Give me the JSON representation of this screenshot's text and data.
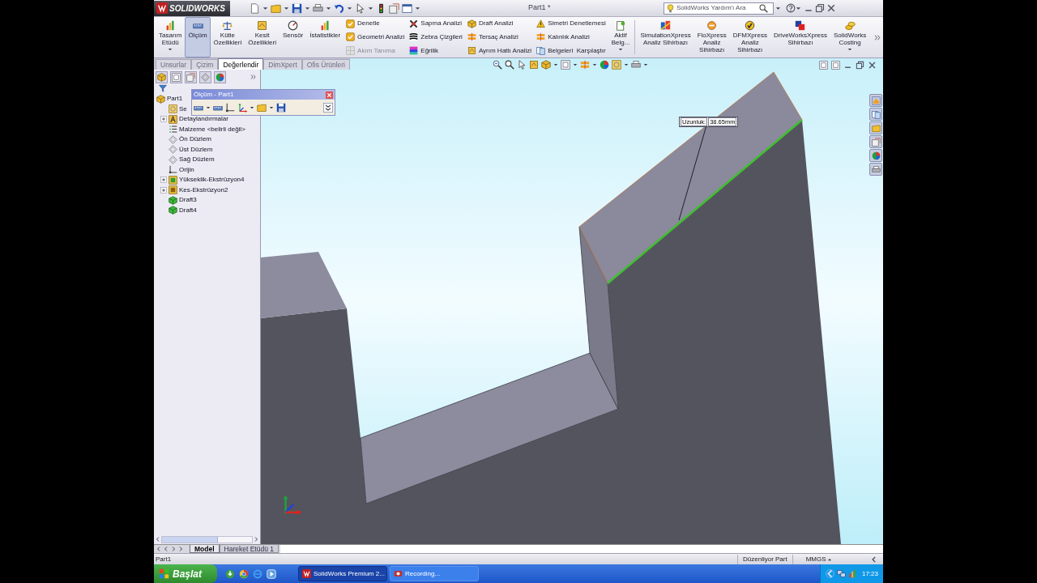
{
  "title_bar": {
    "logo": "SOLIDWORKS",
    "title": "Part1 *",
    "search": {
      "placeholder": "SolidWorks Yardım'ı Ara"
    }
  },
  "ribbon": [
    {
      "kind": "large",
      "label": "Tasarım\nEtüdü",
      "selected": false,
      "menu": true
    },
    {
      "kind": "large",
      "label": "Ölçüm",
      "selected": true
    },
    {
      "kind": "large",
      "label": "Kütle\nÖzellikleri",
      "selected": false
    },
    {
      "kind": "large",
      "label": "Kesit\nÖzellikleri",
      "selected": false
    },
    {
      "kind": "large",
      "label": "Sensör",
      "selected": false
    },
    {
      "kind": "large",
      "label": "İstatistikler",
      "selected": false
    },
    {
      "kind": "column",
      "items": [
        {
          "label": "Denetle",
          "disabled": false
        },
        {
          "label": "Geometri Analizi",
          "disabled": false
        },
        {
          "label": "Akım Tanıma",
          "disabled": true
        }
      ]
    },
    {
      "kind": "column",
      "items": [
        {
          "label": "Sapma Analizi",
          "disabled": false
        },
        {
          "label": "Zebra Çizgileri",
          "disabled": false
        },
        {
          "label": "Eğrilik",
          "disabled": false
        }
      ]
    },
    {
      "kind": "column",
      "items": [
        {
          "label": "Draft Analizi",
          "disabled": false
        },
        {
          "label": "Tersaç Analizi",
          "disabled": false
        },
        {
          "label": "Ayrım Hattı Analizi",
          "disabled": false
        }
      ]
    },
    {
      "kind": "column",
      "items": [
        {
          "label": "Simetri Denetlemesi",
          "disabled": false
        },
        {
          "label": "Kalınlık Analizi",
          "disabled": false
        },
        {
          "label": "Belgeleri  Karşılaştır",
          "disabled": false
        }
      ]
    },
    {
      "kind": "large",
      "label": "Aktif\nBelg...",
      "selected": false,
      "menu": true
    },
    {
      "kind": "separator"
    },
    {
      "kind": "large",
      "label": "SimulationXpress\nAnaliz Sihirbazı",
      "selected": false
    },
    {
      "kind": "large",
      "label": "FloXpress\nAnaliz\nSihirbazı",
      "selected": false
    },
    {
      "kind": "large",
      "label": "DFMXpress\nAnaliz\nSihirbazı",
      "selected": false
    },
    {
      "kind": "large",
      "label": "DriveWorksXpress\nSihirbazı",
      "selected": false
    },
    {
      "kind": "large",
      "label": "SolidWorks\nCosting",
      "selected": false,
      "menu": true
    }
  ],
  "command_tabs": [
    {
      "label": "Unsurlar",
      "selected": false
    },
    {
      "label": "Çizim",
      "selected": false
    },
    {
      "label": "Değerlendir",
      "selected": true
    },
    {
      "label": "DimXpert",
      "selected": false
    },
    {
      "label": "Ofis Ürünleri",
      "selected": false
    }
  ],
  "feature_tree": [
    {
      "label": "Part1",
      "kind": "part",
      "children": [
        {
          "label": "Se",
          "kind": "sensor"
        },
        {
          "label": "Detaylandırmalar",
          "kind": "annotation",
          "expanded": false
        },
        {
          "label": "Malzeme <belirli değil>",
          "kind": "material"
        },
        {
          "label": "Ön Düzlem",
          "kind": "plane"
        },
        {
          "label": "Üst Düzlem",
          "kind": "plane"
        },
        {
          "label": "Sağ Düzlem",
          "kind": "plane"
        },
        {
          "label": "Orijin",
          "kind": "origin"
        },
        {
          "label": "Yükseklik-Ekstrüzyon4",
          "kind": "extrude",
          "expanded": false
        },
        {
          "label": "Kes-Ekstrüzyon2",
          "kind": "cut",
          "expanded": false
        },
        {
          "label": "Draft3",
          "kind": "draft"
        },
        {
          "label": "Draft4",
          "kind": "draft"
        }
      ]
    }
  ],
  "measure_toolbar": {
    "title": "Ölçüm - Part1"
  },
  "measurement": {
    "label": "Uzunluk:",
    "value": "38.65mm"
  },
  "model_tabs": [
    {
      "label": "Model",
      "selected": true
    },
    {
      "label": "Hareket Etüdü 1",
      "selected": false
    }
  ],
  "status_bar": {
    "document": "Part1",
    "mode": "Düzenliyor Part",
    "units": "MMGS"
  },
  "taskbar": {
    "start": "Başlat",
    "tasks": [
      {
        "label": "SolidWorks Premium 2...",
        "selected": true
      },
      {
        "label": "Recording...",
        "selected": false
      }
    ],
    "clock": "17:23"
  }
}
